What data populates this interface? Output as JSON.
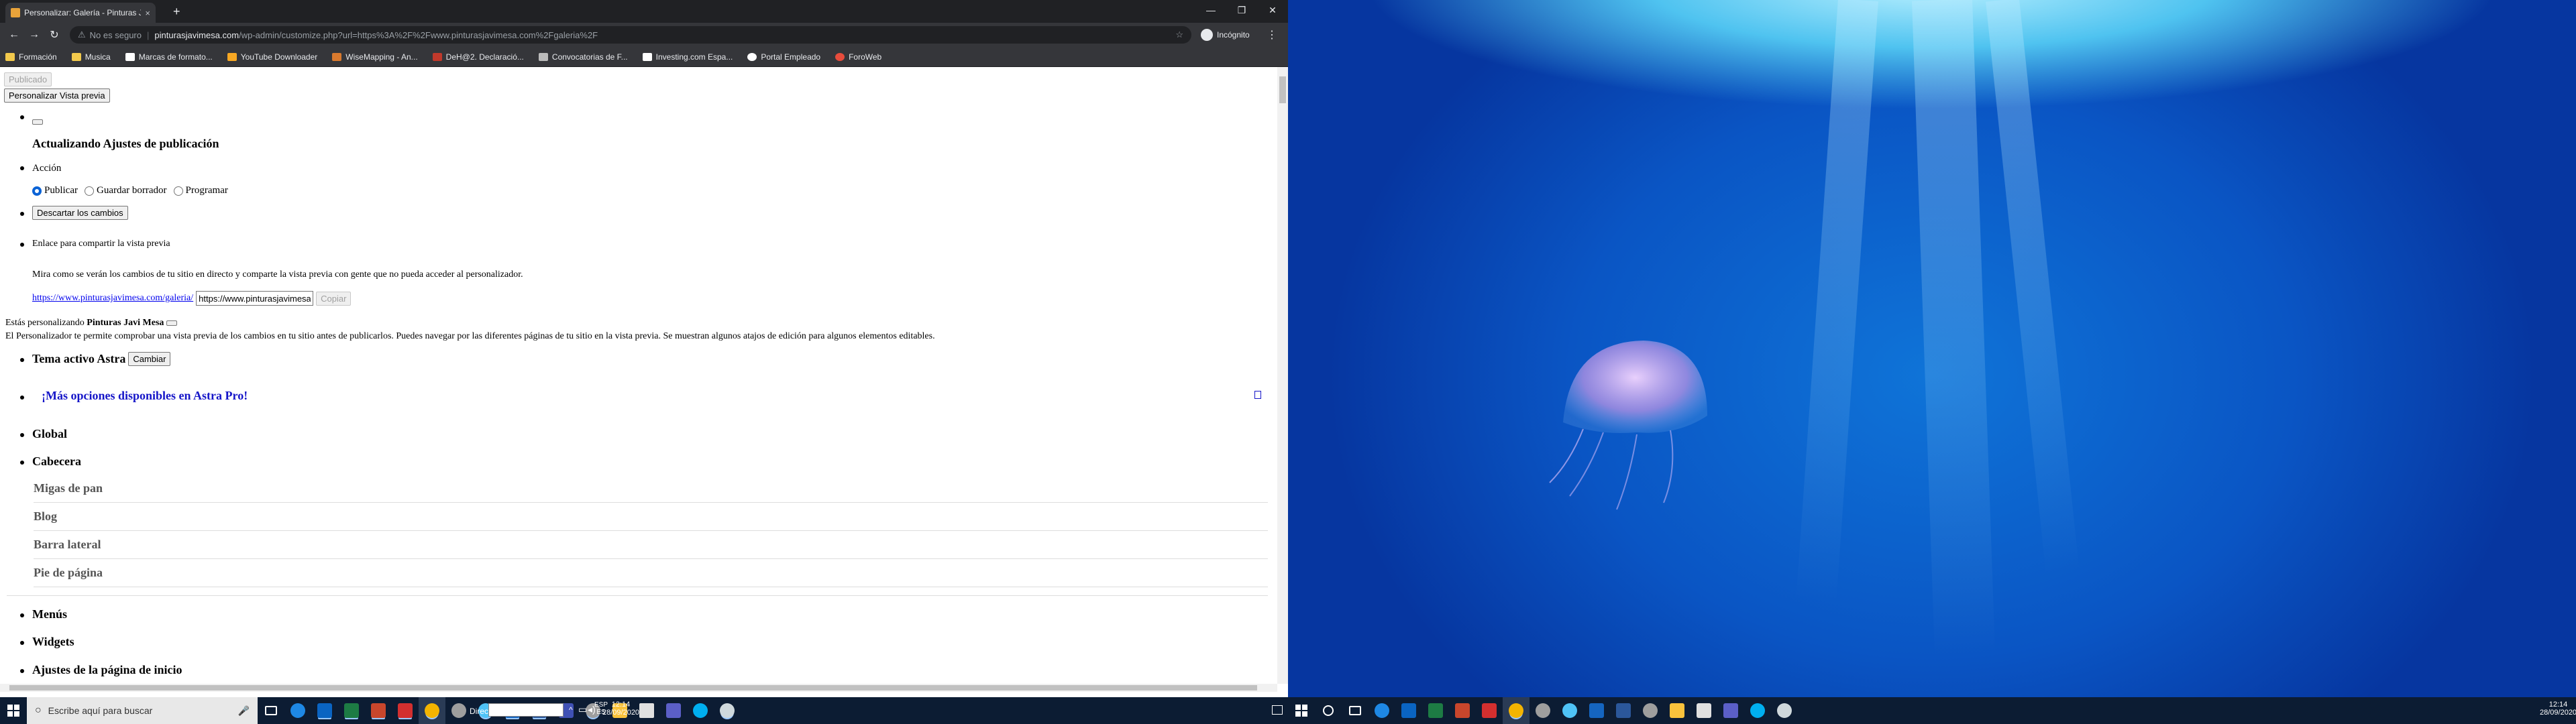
{
  "browser": {
    "tab_title": "Personalizar: Galería - Pinturas Javi",
    "tab_close": "×",
    "new_tab": "+",
    "window_controls": [
      "—",
      "❐",
      "✕"
    ],
    "nav": {
      "back": "←",
      "forward": "→",
      "reload": "↻"
    },
    "security": "No es seguro",
    "url_host": "pinturasjavimesa.com",
    "url_path": "/wp-admin/customize.php?url=https%3A%2F%2Fwww.pinturasjavimesa.com%2Fgaleria%2F",
    "star": "☆",
    "profile": "Incógnito",
    "menu": "⋮",
    "bookmarks": [
      "Formación",
      "Musica",
      "Marcas de formato...",
      "YouTube Downloader",
      "WiseMapping - An...",
      "DeH@2. Declaració...",
      "Convocatorias de F...",
      "Investing.com Espa...",
      "Portal Empleado",
      "ForoWeb"
    ]
  },
  "page": {
    "published_btn": "Publicado",
    "preview_btn": "Personalizar Vista previa",
    "updating_heading": "Actualizando Ajustes de publicación",
    "action_label": "Acción",
    "radios": [
      "Publicar",
      "Guardar borrador",
      "Programar"
    ],
    "discard_btn": "Descartar los cambios",
    "share_label": "Enlace para compartir la vista previa",
    "share_desc": "Mira como se verán los cambios de tu sitio en directo y comparte la vista previa con gente que no pueda acceder al personalizador.",
    "share_link": "https://www.pinturasjavimesa.com/galeria/",
    "share_input": "https://www.pinturasjavimesa",
    "copy_btn": "Copiar",
    "customizing_prefix": "Estás personalizando",
    "site_name": "Pinturas Javi Mesa",
    "intro": "El Personalizador te permite comprobar una vista previa de los cambios en tu sitio antes de publicarlos. Puedes navegar por las diferentes páginas de tu sitio en la vista previa. Se muestran algunos atajos de edición para algunos elementos editables.",
    "theme_label": "Tema activo Astra",
    "change_btn": "Cambiar",
    "pro_link": "¡Más opciones disponibles en Astra Pro!",
    "sections_top": [
      "Global",
      "Cabecera"
    ],
    "subsections": [
      "Migas de pan",
      "Blog",
      "Barra lateral",
      "Pie de página"
    ],
    "sections_bottom": [
      "Menús",
      "Widgets",
      "Ajustes de la página de inicio"
    ]
  },
  "taskbar_left": {
    "search_placeholder": "Escribe aquí para buscar",
    "address_label": "Dirección",
    "lang_top": "ESP",
    "lang_bottom": "ES",
    "time": "12:14",
    "date": "28/09/2020"
  },
  "taskbar_right": {
    "time": "12:14",
    "date": "28/09/2020"
  }
}
